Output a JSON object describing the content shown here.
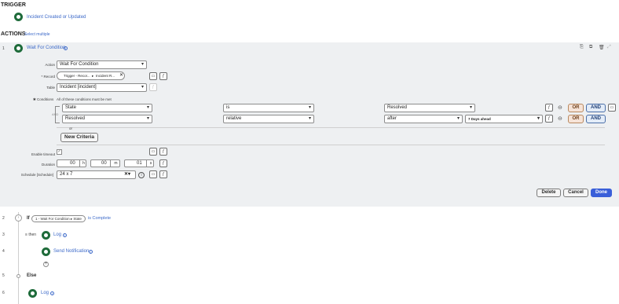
{
  "trigger": {
    "heading": "TRIGGER",
    "name": "Incident Created or Updated"
  },
  "actions": {
    "heading": "ACTIONS",
    "select_multiple": "Select multiple"
  },
  "step1": {
    "number": "1",
    "title": "Wait For Condition",
    "action_label": "Action",
    "action_value": "Wait For Condition",
    "record_label": "Record",
    "record_chip_1": "Trigger - Recor...",
    "record_chip_2": "Incident R...",
    "table_label": "Table",
    "table_value": "Incident [incident]",
    "conditions_label": "Conditions",
    "conditions_note": "All of these conditions must be met",
    "and_connector": "AND",
    "or_label": "or",
    "row1": {
      "field": "State",
      "operator": "is",
      "value": "Resolved"
    },
    "row2": {
      "field": "Resolved",
      "operator": "relative",
      "value": "after",
      "extra": "7 Days ahead"
    },
    "or_button": "OR",
    "and_button": "AND",
    "new_criteria": "New Criteria",
    "enable_timeout_label": "Enable timeout",
    "enable_timeout_checked": true,
    "duration_label": "Duration",
    "duration": {
      "hours": "00",
      "h_unit": "h",
      "minutes": "00",
      "m_unit": "m",
      "seconds": "01",
      "s_unit": "s"
    },
    "schedule_label": "Schedule [Schedule]",
    "schedule_value": "24 x 7",
    "delete_button": "Delete",
    "cancel_button": "Cancel",
    "done_button": "Done"
  },
  "step2": {
    "number": "2",
    "keyword": "If",
    "chip": "1 - Wait For Condition ▸ State",
    "condition": "is Complete"
  },
  "step3": {
    "number": "3",
    "prefix": "then",
    "title": "Log"
  },
  "step4": {
    "number": "4",
    "title": "Send Notification"
  },
  "step5": {
    "number": "5",
    "keyword": "Else"
  },
  "step6": {
    "number": "6",
    "title": "Log"
  },
  "colors": {
    "accent": "#3a5fd9",
    "link": "#3d6ac9",
    "step_icon": "#1e6b3a",
    "panel_bg": "#eef0f2",
    "or_bg": "#f6e3d7",
    "and_bg": "#e3ecf8"
  },
  "icons": [
    "flow-step-icon",
    "info-icon",
    "copy-icon",
    "duplicate-icon",
    "trash-icon",
    "expand-icon",
    "data-pill-icon",
    "script-icon",
    "remove-condition-icon",
    "clear-icon",
    "plus-icon",
    "checkbox-icon"
  ]
}
